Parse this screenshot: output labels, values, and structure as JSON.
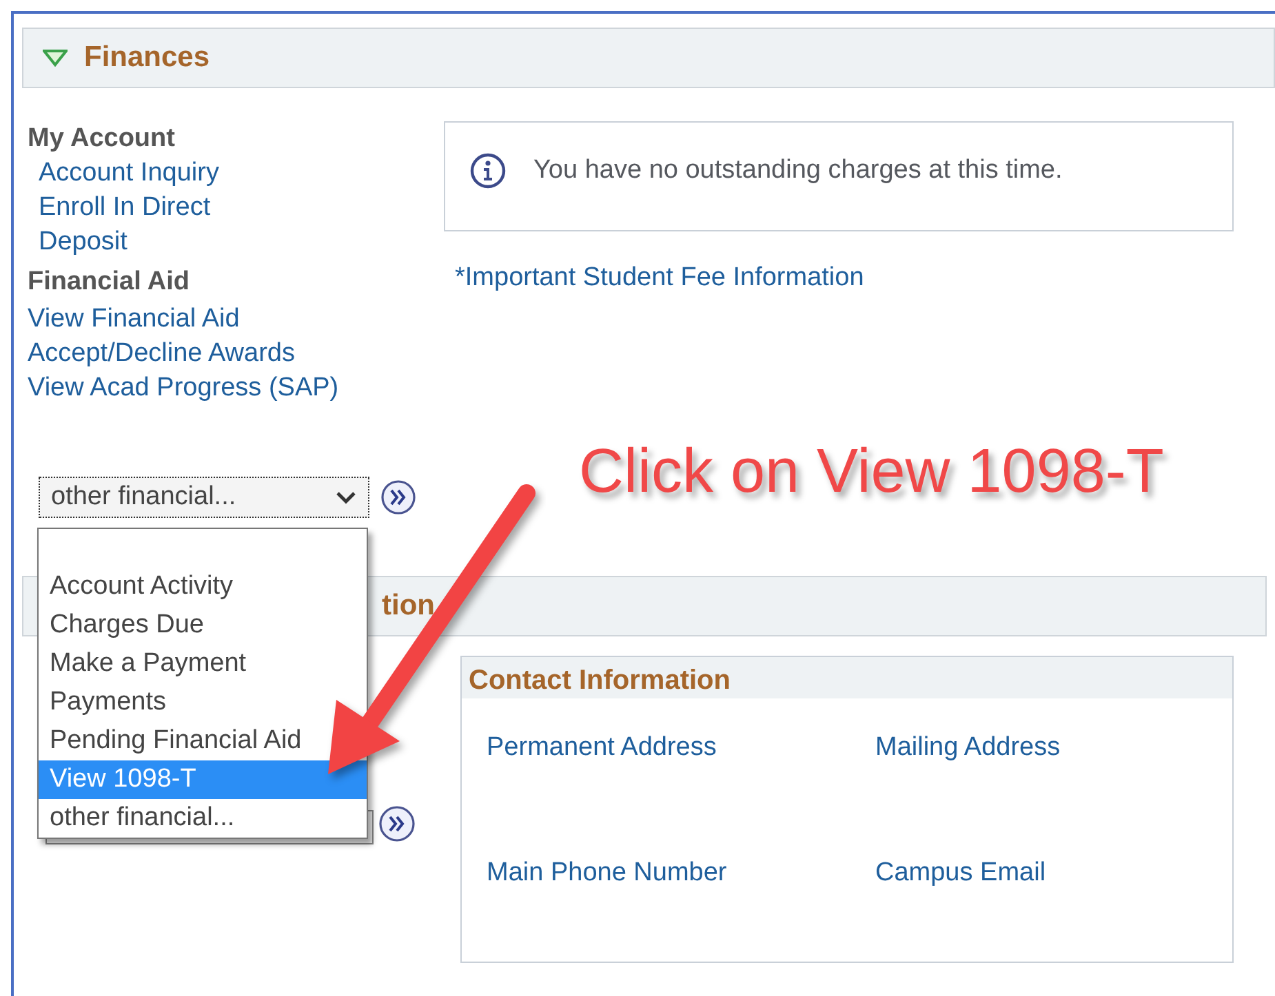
{
  "section": {
    "title": "Finances",
    "expanded": true
  },
  "my_account": {
    "heading": "My Account",
    "links": [
      "Account Inquiry",
      "Enroll In Direct Deposit"
    ]
  },
  "financial_aid": {
    "heading": "Financial Aid",
    "links": [
      "View Financial Aid",
      "Accept/Decline Awards",
      "View Acad Progress (SAP)"
    ]
  },
  "other_select": {
    "value": "other financial...",
    "expanded": true,
    "options": [
      {
        "label": "Account Activity",
        "highlighted": false
      },
      {
        "label": "Charges Due",
        "highlighted": false
      },
      {
        "label": "Make a Payment",
        "highlighted": false
      },
      {
        "label": "Payments",
        "highlighted": false
      },
      {
        "label": "Pending Financial Aid",
        "highlighted": false
      },
      {
        "label": "View 1098-T",
        "highlighted": true
      },
      {
        "label": "other financial...",
        "highlighted": false
      }
    ]
  },
  "message": "You have no outstanding charges at this time.",
  "fee_link": "*Important Student Fee Information",
  "section_2": {
    "title": "tion"
  },
  "contact": {
    "title": "Contact Information",
    "fields": [
      "Permanent Address",
      "Mailing Address",
      "Main Phone Number",
      "Campus Email"
    ]
  },
  "annotation": {
    "text": "Click on View 1098-T"
  }
}
